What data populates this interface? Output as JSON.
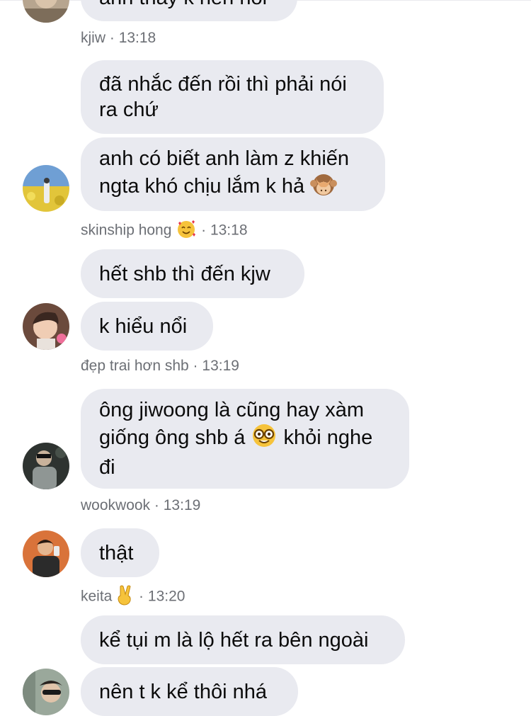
{
  "messages": [
    {
      "sender": "kjiw",
      "time": "13:18",
      "bubbles": [
        "anh thấy k nên nói"
      ]
    },
    {
      "sender": "skinship hong",
      "sender_emoji": "smiling-face-with-hearts",
      "time": "13:18",
      "bubbles": [
        "đã nhắc đến rồi thì phải nói ra chứ",
        "anh có biết anh làm z khiến ngta khó chịu lắm k hả"
      ],
      "bubble_emoji": "see-no-evil-monkey"
    },
    {
      "sender": "đẹp trai hơn shb",
      "time": "13:19",
      "bubbles": [
        "hết shb thì đến kjw",
        "k hiểu nổi"
      ]
    },
    {
      "sender": "wookwook",
      "time": "13:19",
      "bubble_parts": [
        "ông jiwoong là cũng hay xàm giống ông shb á",
        "khỏi nghe đi"
      ],
      "bubble_emoji": "nerd-face"
    },
    {
      "sender": "keita",
      "sender_emoji": "victory-hand",
      "time": "13:20",
      "bubbles": [
        "thật"
      ]
    },
    {
      "bubbles": [
        "kể tụi m là lộ hết ra bên ngoài",
        "nên t k kể thôi nhá"
      ]
    }
  ],
  "separator": "·"
}
